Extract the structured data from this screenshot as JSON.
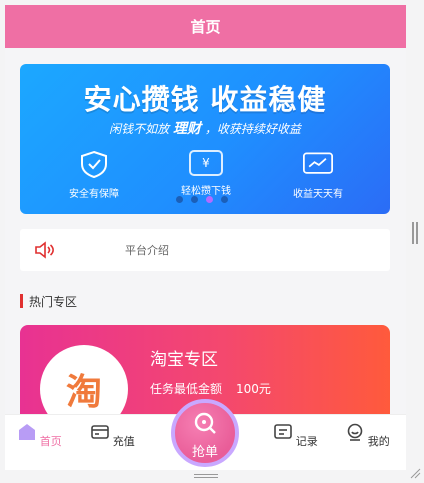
{
  "header": {
    "title": "首页"
  },
  "banner": {
    "title": "安心攒钱 收益稳健",
    "subtitle_a": "闲钱不如放",
    "subtitle_b": "理财",
    "subtitle_c": "，收获持续好收益",
    "features": [
      {
        "label": "安全有保障",
        "icon": "shield-check-icon"
      },
      {
        "label": "轻松攒下钱",
        "icon": "yen-card-icon"
      },
      {
        "label": "收益天天有",
        "icon": "trend-chart-icon"
      }
    ],
    "active_slide": 3,
    "slide_count": 4
  },
  "notice": {
    "text": "平台介绍",
    "icon": "speaker-icon"
  },
  "section": {
    "title": "热门专区"
  },
  "zone": {
    "logo_text": "淘",
    "name": "淘宝专区",
    "min_label": "任务最低金额",
    "min_value": "100元"
  },
  "tabs": [
    {
      "label": "首页",
      "icon": "home-icon"
    },
    {
      "label": "充值",
      "icon": "wallet-icon"
    },
    {
      "label": "抢单",
      "icon": "grab-order-icon"
    },
    {
      "label": "记录",
      "icon": "record-icon"
    },
    {
      "label": "我的",
      "icon": "user-icon"
    }
  ],
  "colors": {
    "primary": "#ef6fa4",
    "banner": "#1f8fff",
    "accent": "#e03030"
  }
}
